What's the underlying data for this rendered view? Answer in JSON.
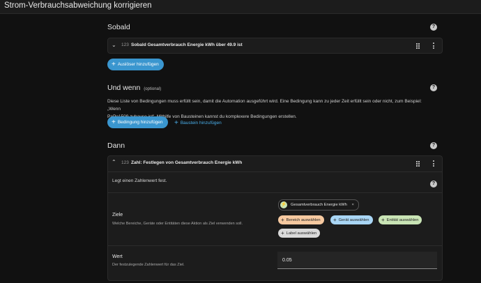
{
  "header": {
    "title": "Strom-Verbrauchsabweichung korrigieren"
  },
  "sobald": {
    "title": "Sobald",
    "help_icon": "help-circle-icon",
    "trigger": {
      "number_icon": "123",
      "label": "Sobald Gesamtverbrauch Energie kWh über 49.9 ist"
    },
    "add_button": "Auslöser hinzufügen"
  },
  "und_wenn": {
    "title": "Und wenn",
    "optional": "(optional)",
    "description_line1": "Diese Liste von Bedingungen muss erfüllt sein, damit die Automation ausgeführt wird. Eine Bedingung kann zu jeder Zeit erfüllt sein oder nicht, zum Beispiel: „Wenn",
    "description_line2": "PaPo1509 zuhause ist“. Mithilfe von Bausteinen kannst du komplexere Bedingungen erstellen.",
    "add_condition_button": "Bedingung hinzufügen",
    "add_block_button": "Baustein hinzufügen"
  },
  "dann": {
    "title": "Dann",
    "action": {
      "number_icon": "123",
      "label": "Zahl: Festlegen von Gesamtverbrauch Energie kWh",
      "description": "Legt einen Zahlenwert fest.",
      "targets": {
        "label": "Ziele",
        "sublabel": "Welche Bereiche, Geräte oder Entitäten diese Aktion als Ziel verwenden soll.",
        "selected_entity": "Gesamtverbrauch Energie kWh",
        "remove_symbol": "×",
        "chips": [
          {
            "label": "Bereich auswählen",
            "color": "#f6c9a0"
          },
          {
            "label": "Gerät auswählen",
            "color": "#a9d6f5"
          },
          {
            "label": "Entität auswählen",
            "color": "#c9e4b5"
          },
          {
            "label": "Label auswählen",
            "color": "#d9d9d9"
          }
        ]
      },
      "value": {
        "label": "Wert",
        "sublabel": "Der festzulegende Zahlenwert für das Ziel.",
        "current_value": "0.05"
      }
    }
  }
}
